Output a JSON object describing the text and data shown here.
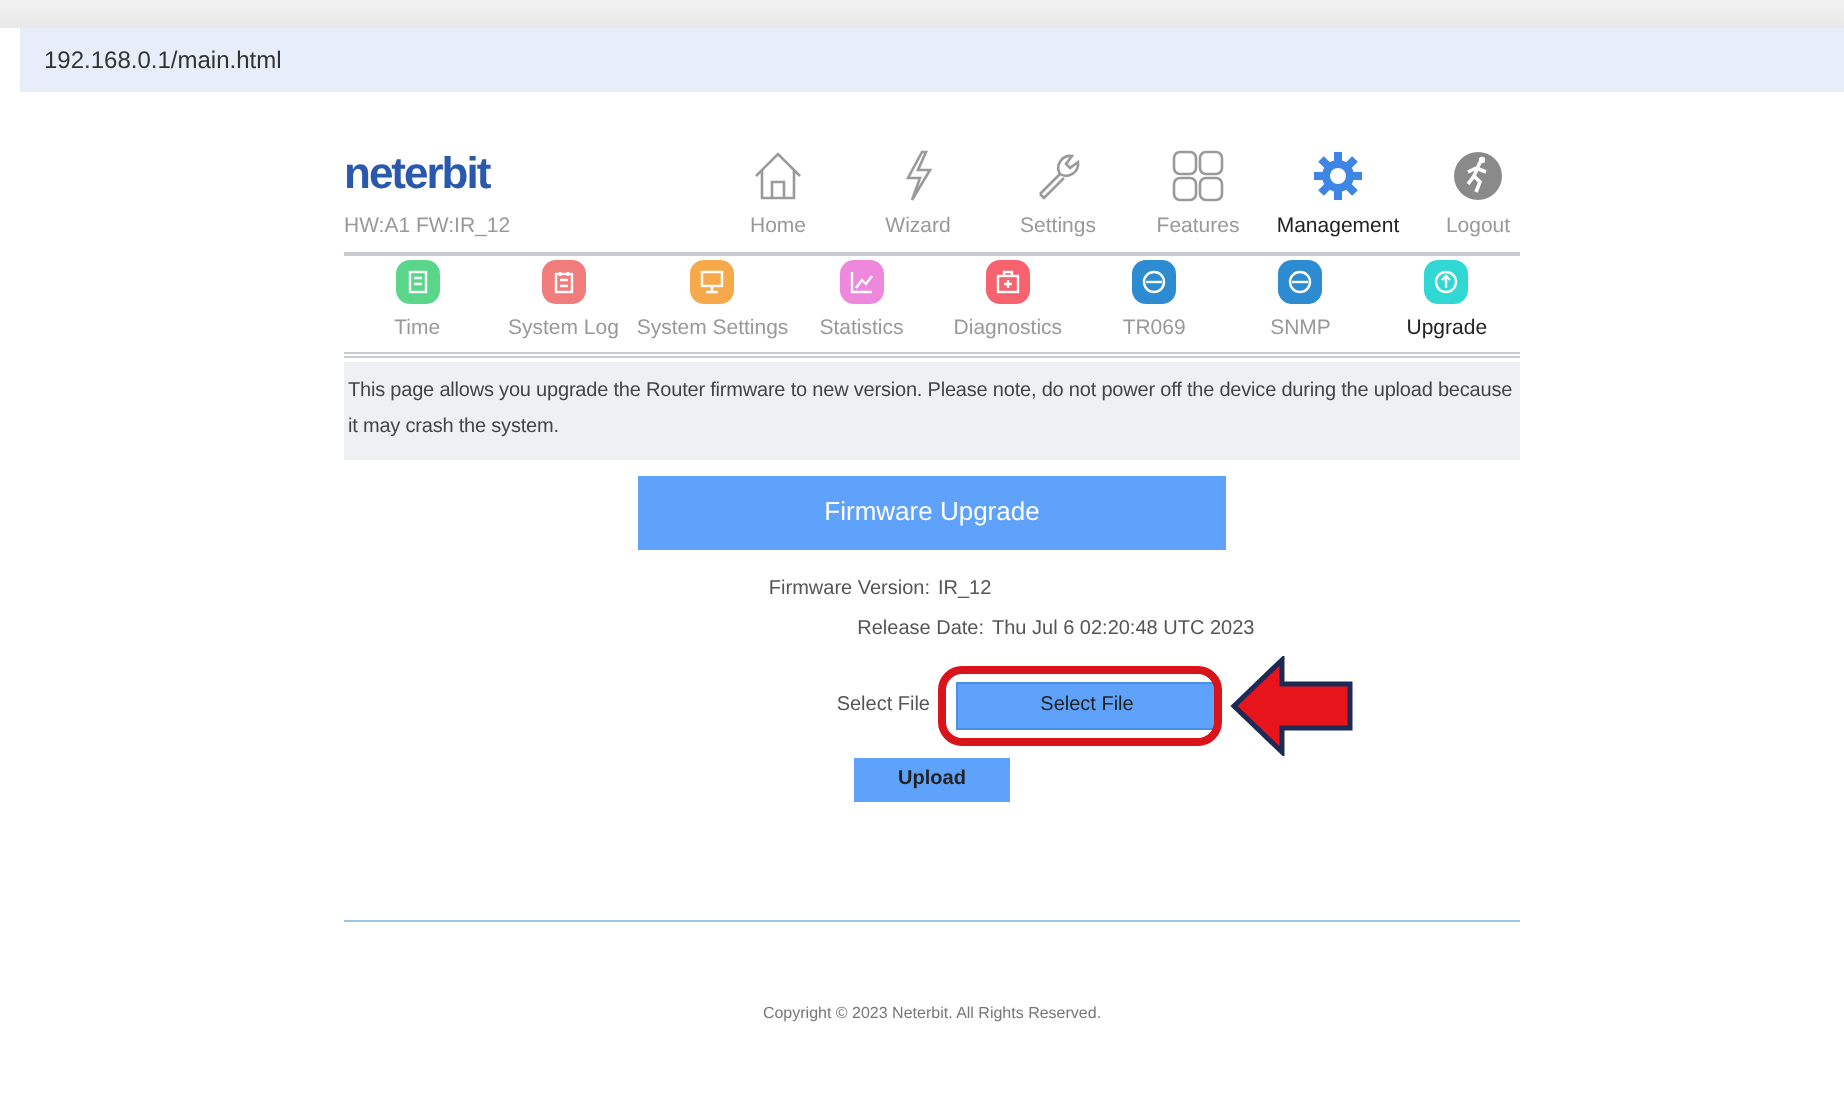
{
  "address_bar": {
    "url": "192.168.0.1/main.html"
  },
  "header": {
    "logo": "neterbit",
    "hw_info": "HW:A1 FW:IR_12"
  },
  "top_nav": [
    {
      "label": "Home",
      "selected": false
    },
    {
      "label": "Wizard",
      "selected": false
    },
    {
      "label": "Settings",
      "selected": false
    },
    {
      "label": "Features",
      "selected": false
    },
    {
      "label": "Management",
      "selected": true
    },
    {
      "label": "Logout",
      "selected": false
    }
  ],
  "sub_nav": [
    {
      "label": "Time",
      "color": "#5ad68a",
      "selected": false
    },
    {
      "label": "System Log",
      "color": "#f07c7c",
      "selected": false
    },
    {
      "label": "System Settings",
      "color": "#f5a94a",
      "selected": false
    },
    {
      "label": "Statistics",
      "color": "#ee88dc",
      "selected": false
    },
    {
      "label": "Diagnostics",
      "color": "#f6626e",
      "selected": false
    },
    {
      "label": "TR069",
      "color": "#2d8bd2",
      "selected": false
    },
    {
      "label": "SNMP",
      "color": "#2d8bd2",
      "selected": false
    },
    {
      "label": "Upgrade",
      "color": "#2fd8d2",
      "selected": true
    }
  ],
  "note": "This page allows you upgrade the Router firmware to new version. Please note, do not power off the device during the upload because it may crash the system.",
  "panel": {
    "title": "Firmware Upgrade",
    "fields": [
      {
        "label": "Firmware Version:",
        "value": "IR_12"
      },
      {
        "label": "Release Date:",
        "value": "Thu Jul 6 02:20:48 UTC 2023"
      }
    ],
    "select_file": {
      "label": "Select File",
      "button": "Select File",
      "highlighted": true
    },
    "upload_button": "Upload"
  },
  "footer": "Copyright © 2023 Neterbit. All Rights Reserved."
}
